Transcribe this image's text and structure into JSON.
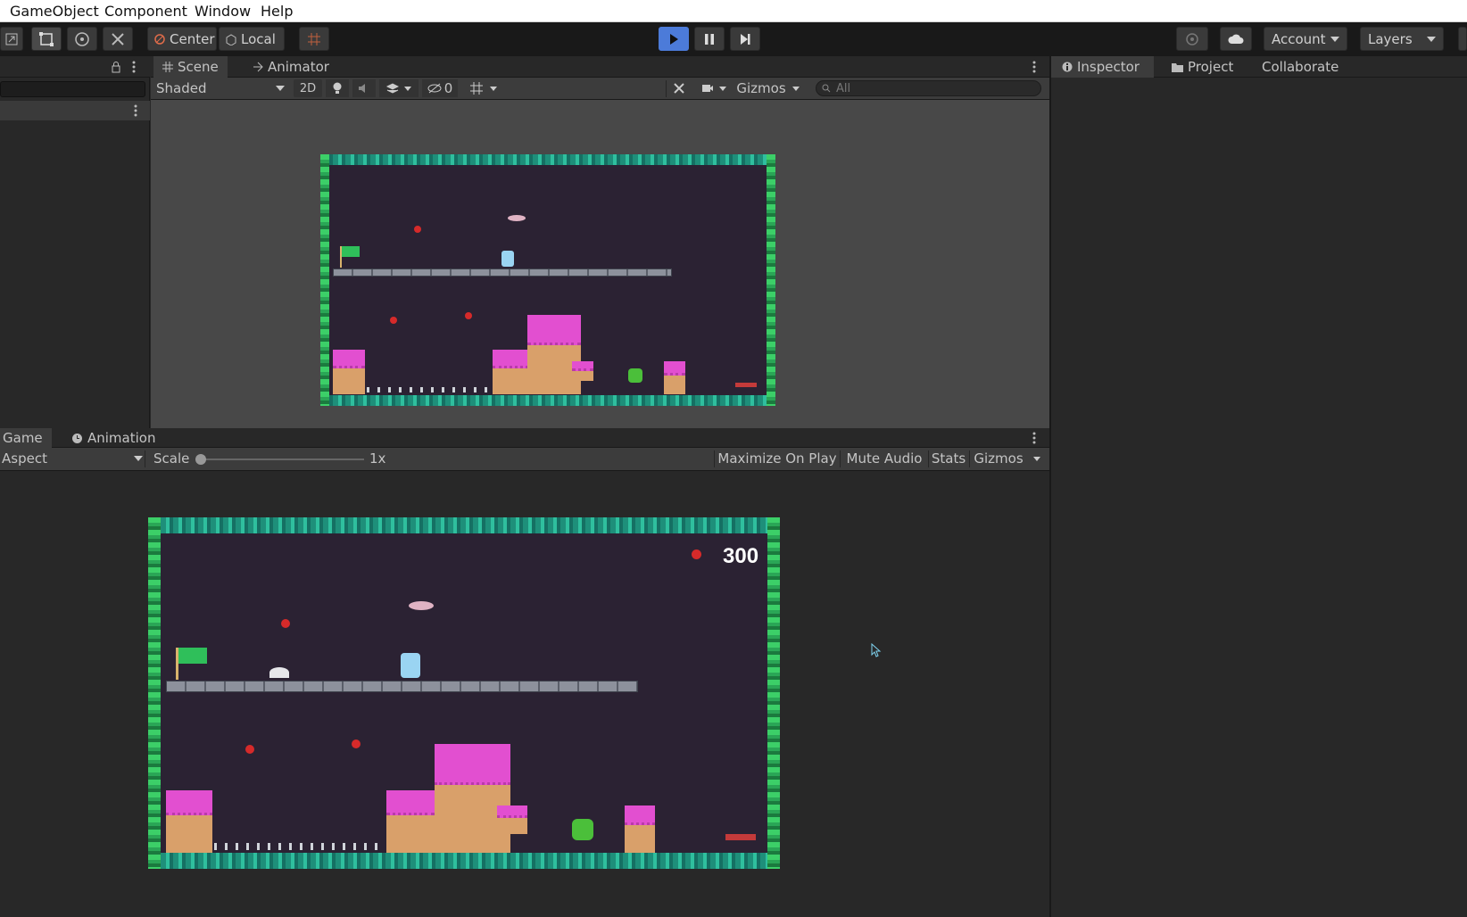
{
  "menubar": {
    "items": [
      "GameObject",
      "Component",
      "Window",
      "Help"
    ]
  },
  "toolbar": {
    "pivot_label": "Center",
    "space_label": "Local",
    "account_label": "Account",
    "layers_label": "Layers"
  },
  "scene_panel": {
    "tabs": [
      "Scene",
      "Animator"
    ],
    "shading_mode": "Shaded",
    "mode_2d": "2D",
    "hidden_count": "0",
    "gizmos_label": "Gizmos",
    "search_placeholder": "All"
  },
  "game_panel": {
    "tabs": [
      "Game",
      "Animation"
    ],
    "aspect_label": "Aspect",
    "scale_label": "Scale",
    "scale_value": "1x",
    "maximize_label": "Maximize On Play",
    "mute_label": "Mute Audio",
    "stats_label": "Stats",
    "gizmos_label": "Gizmos",
    "score": "300"
  },
  "inspector_panel": {
    "tabs": [
      "Inspector",
      "Project",
      "Collaborate"
    ]
  },
  "colors": {
    "editor_bg": "#282828",
    "toolbar_bg": "#191919",
    "play_active": "#4c7bd9",
    "game_bg": "#2b2233",
    "brick_green": "#3ccf68",
    "candy_pink": "#e24fd0"
  },
  "icons": [
    "rect-tool-icon",
    "rotate-tool-icon",
    "transform-tool-icon",
    "grid-snap-icon",
    "play-icon",
    "pause-icon",
    "step-icon",
    "collab-icon",
    "cloud-icon",
    "lock-icon",
    "kebab-icon",
    "light-icon",
    "audio-icon",
    "effects-icon",
    "visibility-icon",
    "grid-icon",
    "tools-icon",
    "camera-icon",
    "search-icon",
    "clock-icon",
    "info-icon",
    "folder-icon",
    "cursor-icon"
  ]
}
